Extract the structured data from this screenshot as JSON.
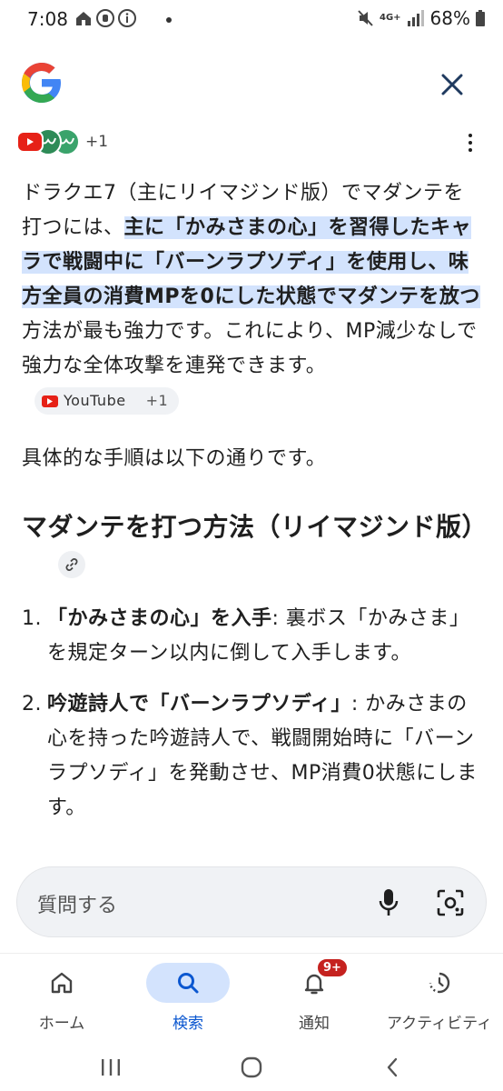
{
  "status_bar": {
    "time": "7:08",
    "network": "4G+",
    "battery": "68%"
  },
  "header": {
    "logo": "google-g-logo",
    "close_icon": "close-icon"
  },
  "sources": {
    "count_label": "+1"
  },
  "answer": {
    "intro": "ドラクエ7（主にリイマジンド版）でマダンテを打つには、",
    "highlight": "主に「かみさまの心」を習得したキャラで戦闘中に「バーンラプソディ」を使用し、味方全員の消費MPを0にした状態でマダンテを放つ",
    "outro": "方法が最も強力です。これにより、MP減少なしで強力な全体攻撃を連発できます。",
    "chip_label": "YouTube",
    "chip_count": "+1",
    "para2": "具体的な手順は以下の通りです。"
  },
  "section": {
    "title": "マダンテを打つ方法（リイマジンド版）"
  },
  "steps": [
    {
      "num": "1.",
      "bold": "「かみさまの心」を入手",
      "text": ": 裏ボス「かみさま」を規定ターン以内に倒して入手します。"
    },
    {
      "num": "2.",
      "bold": "吟遊詩人で「バーンラプソディ」",
      "text": ": かみさまの心を持った吟遊詩人で、戦闘開始時に「バーンラプソディ」を発動させ、MP消費0状態にします。"
    }
  ],
  "ask": {
    "placeholder": "質問する"
  },
  "bottom_nav": {
    "items": [
      {
        "label": "ホーム",
        "icon": "home-icon"
      },
      {
        "label": "検索",
        "icon": "search-icon"
      },
      {
        "label": "通知",
        "icon": "bell-icon",
        "badge": "9+"
      },
      {
        "label": "アクティビティ",
        "icon": "activity-icon"
      }
    ]
  },
  "colors": {
    "highlight": "#d3e3fd",
    "accent": "#0b57d0",
    "badge": "#c5221f"
  }
}
